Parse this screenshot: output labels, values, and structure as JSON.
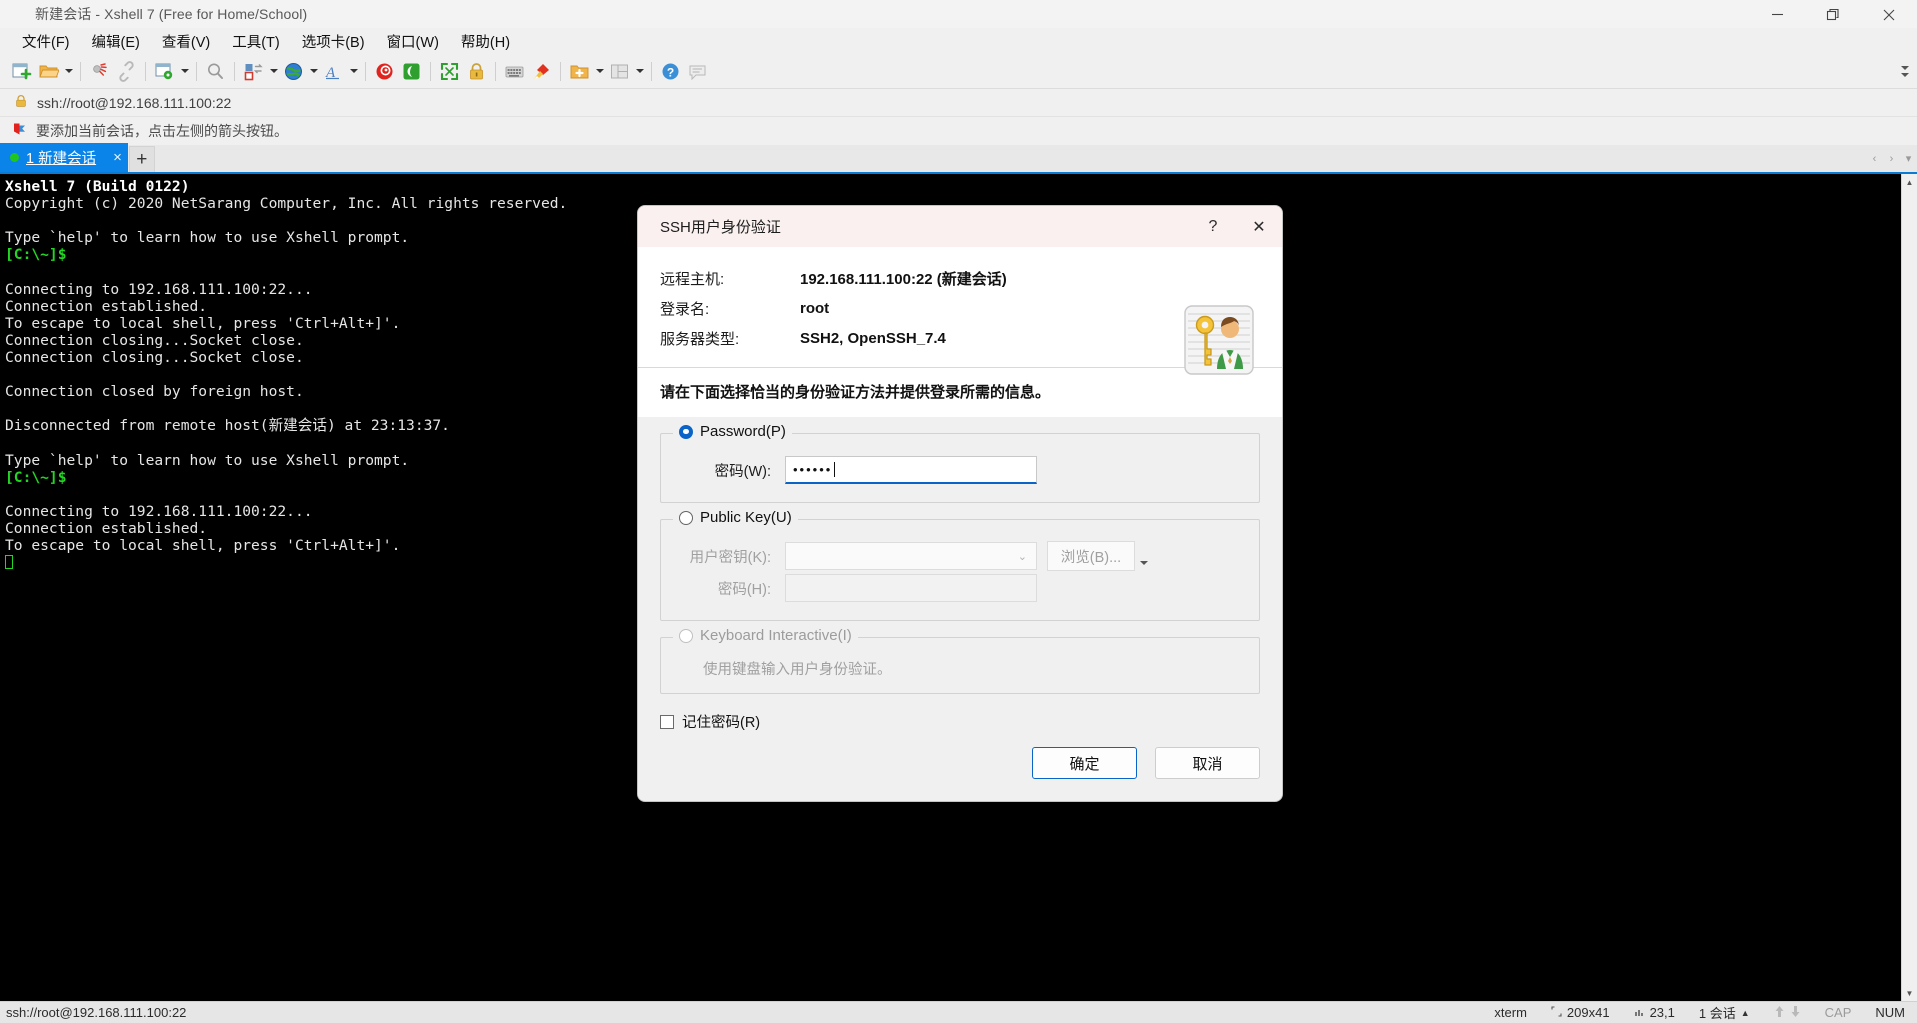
{
  "window": {
    "title": "新建会话 - Xshell 7 (Free for Home/School)",
    "app_icon": "xshell-spiral-icon",
    "controls": {
      "minimize": "minimize-icon",
      "restore": "restore-icon",
      "close": "close-icon"
    }
  },
  "menubar": {
    "items": [
      {
        "label": "文件(F)",
        "name": "menu-file"
      },
      {
        "label": "编辑(E)",
        "name": "menu-edit"
      },
      {
        "label": "查看(V)",
        "name": "menu-view"
      },
      {
        "label": "工具(T)",
        "name": "menu-tools"
      },
      {
        "label": "选项卡(B)",
        "name": "menu-tab"
      },
      {
        "label": "窗口(W)",
        "name": "menu-window"
      },
      {
        "label": "帮助(H)",
        "name": "menu-help"
      }
    ]
  },
  "toolbar": {
    "icons": [
      "new-session-icon",
      "open-folder-icon",
      "session-manager-icon",
      "link-icon",
      "properties-icon",
      "find-icon",
      "transfer-icon",
      "globe-icon",
      "font-icon",
      "xshell-icon",
      "xftp-icon",
      "fullscreen-icon",
      "lock-icon",
      "keyboard-icon",
      "highlight-icon",
      "add-folder-icon",
      "layout-icon",
      "help-icon",
      "comment-icon"
    ],
    "overflow": "toolbar-overflow-chevron"
  },
  "address": {
    "lock_icon": "lock-icon",
    "url": "ssh://root@192.168.111.100:22"
  },
  "notice": {
    "flag_icon": "bookmark-flag-icon",
    "text": "要添加当前会话，点击左侧的箭头按钮。"
  },
  "tabs": {
    "items": [
      {
        "label": "1 新建会话",
        "status": "connected",
        "close": "×"
      }
    ],
    "add_label": "+",
    "nav": {
      "left": "‹",
      "right": "›",
      "list": "▾"
    }
  },
  "terminal": {
    "lines": [
      {
        "text": "Xshell 7 (Build 0122)",
        "style": "bold"
      },
      {
        "text": "Copyright (c) 2020 NetSarang Computer, Inc. All rights reserved.",
        "style": "normal"
      },
      {
        "text": "",
        "style": "normal"
      },
      {
        "text": "Type `help' to learn how to use Xshell prompt.",
        "style": "normal"
      },
      {
        "text": "[C:\\~]$",
        "style": "green"
      },
      {
        "text": "",
        "style": "normal"
      },
      {
        "text": "Connecting to 192.168.111.100:22...",
        "style": "normal"
      },
      {
        "text": "Connection established.",
        "style": "normal"
      },
      {
        "text": "To escape to local shell, press 'Ctrl+Alt+]'.",
        "style": "normal"
      },
      {
        "text": "Connection closing...Socket close.",
        "style": "normal"
      },
      {
        "text": "Connection closing...Socket close.",
        "style": "normal"
      },
      {
        "text": "",
        "style": "normal"
      },
      {
        "text": "Connection closed by foreign host.",
        "style": "normal"
      },
      {
        "text": "",
        "style": "normal"
      },
      {
        "text": "Disconnected from remote host(新建会话) at 23:13:37.",
        "style": "normal"
      },
      {
        "text": "",
        "style": "normal"
      },
      {
        "text": "Type `help' to learn how to use Xshell prompt.",
        "style": "normal"
      },
      {
        "text": "[C:\\~]$",
        "style": "green"
      },
      {
        "text": "",
        "style": "normal"
      },
      {
        "text": "Connecting to 192.168.111.100:22...",
        "style": "normal"
      },
      {
        "text": "Connection established.",
        "style": "normal"
      },
      {
        "text": "To escape to local shell, press 'Ctrl+Alt+]'.",
        "style": "normal"
      }
    ],
    "cursor": "block-cursor"
  },
  "dialog": {
    "title": "SSH用户身份验证",
    "help_label": "?",
    "close_label": "✕",
    "banner_icon": "key-user-icon",
    "info": [
      {
        "label": "远程主机:",
        "value": "192.168.111.100:22 (新建会话)"
      },
      {
        "label": "登录名:",
        "value": "root"
      },
      {
        "label": "服务器类型:",
        "value": "SSH2, OpenSSH_7.4"
      }
    ],
    "hint": "请在下面选择恰当的身份验证方法并提供登录所需的信息。",
    "password_group": {
      "legend": "Password(P)",
      "selected": true,
      "field_label": "密码(W):",
      "value": "••••••",
      "placeholder": ""
    },
    "publickey_group": {
      "legend": "Public Key(U)",
      "selected": false,
      "key_label": "用户密钥(K):",
      "key_value": "",
      "browse_label": "浏览(B)...",
      "password_label": "密码(H):",
      "password_value": ""
    },
    "keyboard_group": {
      "legend": "Keyboard Interactive(I)",
      "selected": false,
      "description": "使用键盘输入用户身份验证。"
    },
    "remember": {
      "label": "记住密码(R)",
      "checked": false
    },
    "ok_label": "确定",
    "cancel_label": "取消",
    "accent_color": "#0a64c8"
  },
  "statusbar": {
    "connection": "ssh://root@192.168.111.100:22",
    "term_type": "xterm",
    "size": "209x41",
    "cursor_pos": "23,1",
    "sessions": "1 会话",
    "cap": "CAP",
    "num": "NUM"
  }
}
